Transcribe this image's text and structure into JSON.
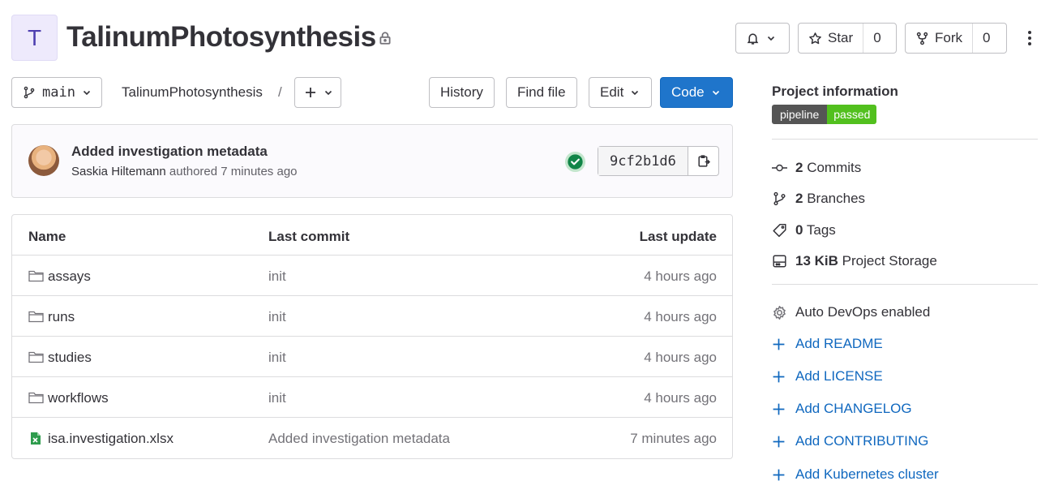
{
  "project": {
    "avatar_letter": "T",
    "name": "TalinumPhotosynthesis"
  },
  "header": {
    "star_label": "Star",
    "star_count": "0",
    "fork_label": "Fork",
    "fork_count": "0"
  },
  "toolbar": {
    "branch": "main",
    "breadcrumb": "TalinumPhotosynthesis",
    "breadcrumb_sep": "/",
    "history_label": "History",
    "find_file_label": "Find file",
    "edit_label": "Edit",
    "code_label": "Code"
  },
  "commit": {
    "title": "Added investigation metadata",
    "author": "Saskia Hiltemann",
    "meta": "authored 7 minutes ago",
    "sha": "9cf2b1d6"
  },
  "tree": {
    "headers": {
      "name": "Name",
      "last_commit": "Last commit",
      "last_update": "Last update"
    },
    "rows": [
      {
        "name": "assays",
        "commit": "init",
        "updated": "4 hours ago",
        "kind": "folder"
      },
      {
        "name": "runs",
        "commit": "init",
        "updated": "4 hours ago",
        "kind": "folder"
      },
      {
        "name": "studies",
        "commit": "init",
        "updated": "4 hours ago",
        "kind": "folder"
      },
      {
        "name": "workflows",
        "commit": "init",
        "updated": "4 hours ago",
        "kind": "folder"
      },
      {
        "name": "isa.investigation.xlsx",
        "commit": "Added investigation metadata",
        "updated": "7 minutes ago",
        "kind": "spreadsheet"
      }
    ]
  },
  "sidebar": {
    "title": "Project information",
    "badge_left": "pipeline",
    "badge_right": "passed",
    "stats": [
      {
        "count": "2",
        "label": "Commits"
      },
      {
        "count": "2",
        "label": "Branches"
      },
      {
        "count": "0",
        "label": "Tags"
      },
      {
        "count": "13 KiB",
        "label": "Project Storage"
      }
    ],
    "devops": "Auto DevOps enabled",
    "links": [
      "Add README",
      "Add LICENSE",
      "Add CHANGELOG",
      "Add CONTRIBUTING",
      "Add Kubernetes cluster"
    ]
  },
  "colors": {
    "primary": "#1f75cb",
    "link": "#1068bf",
    "success": "#108548",
    "badge_pass": "#52c01e"
  }
}
